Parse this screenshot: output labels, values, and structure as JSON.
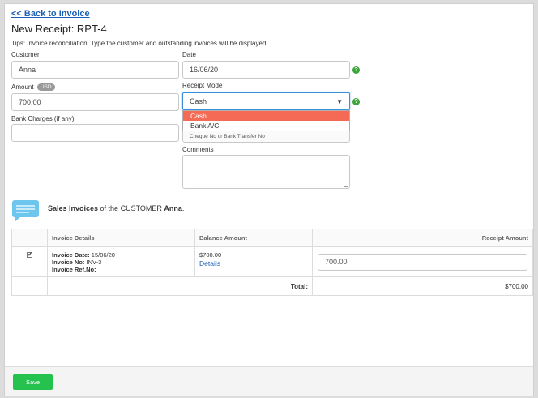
{
  "nav": {
    "back_label": "<< Back to Invoice"
  },
  "header": {
    "title": "New Receipt: RPT-4"
  },
  "tips": "Tips: Invoice reconciliation: Type the customer and outstanding invoices will be displayed",
  "form": {
    "customer": {
      "label": "Customer",
      "value": "Anna"
    },
    "date": {
      "label": "Date",
      "value": "16/06/20"
    },
    "amount": {
      "label": "Amount",
      "currency": "USD",
      "value": "700.00"
    },
    "receipt_mode": {
      "label": "Receipt Mode",
      "selected": "Cash",
      "options": [
        "Cash",
        "Bank A/C"
      ]
    },
    "bank_charges": {
      "label": "Bank Charges (if any)",
      "value": ""
    },
    "reference_hint": "Cheque No or Bank Transfer No",
    "comments": {
      "label": "Comments",
      "value": ""
    }
  },
  "sales": {
    "prefix": "Sales Invoices",
    "middle": " of the CUSTOMER ",
    "customer": "Anna",
    "suffix": "."
  },
  "table": {
    "headers": [
      "",
      "Invoice Details",
      "Balance Amount",
      "Receipt Amount"
    ],
    "rows": [
      {
        "checked": "✔",
        "date_label": "Invoice Date:",
        "date_value": "15/06/20",
        "no_label": "Invoice No:",
        "no_value": "INV-3",
        "ref_label": "Invoice Ref.No:",
        "ref_value": "",
        "balance": "$700.00",
        "details_link": "Details",
        "receipt_amount": "700.00"
      }
    ],
    "total_label": "Total:",
    "total_value": "$700.00"
  },
  "footer": {
    "save_label": "Save"
  },
  "colors": {
    "link": "#1a5fb4",
    "selected_option": "#f46a55",
    "save_button": "#26c24e",
    "help_icon": "#3aa53a"
  },
  "icons": {
    "help": "help-icon",
    "dropdown": "caret-down-icon",
    "bubble": "speech-bubble-icon"
  },
  "help_glyph": "?"
}
